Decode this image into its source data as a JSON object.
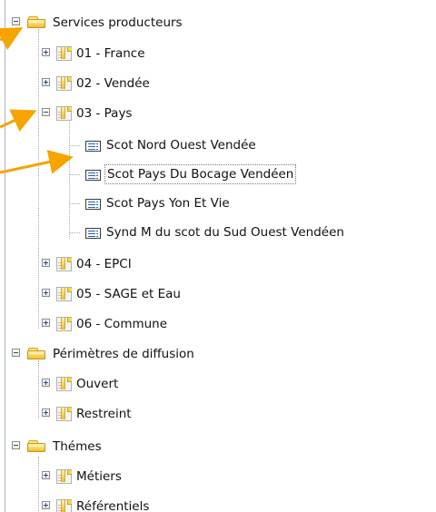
{
  "tree": {
    "services": {
      "label": "Services producteurs",
      "children": [
        {
          "label": "01 - France"
        },
        {
          "label": "02 - Vendée"
        },
        {
          "label": "03 - Pays",
          "children": [
            {
              "label": "Scot Nord Ouest Vendée"
            },
            {
              "label": "Scot Pays Du Bocage Vendéen"
            },
            {
              "label": "Scot Pays Yon Et Vie"
            },
            {
              "label": "Synd M du scot du Sud Ouest Vendéen"
            }
          ]
        },
        {
          "label": "04 - EPCI"
        },
        {
          "label": "05 - SAGE et Eau"
        },
        {
          "label": "06 - Commune"
        }
      ]
    },
    "perimetres": {
      "label": "Périmètres de diffusion",
      "children": [
        {
          "label": "Ouvert"
        },
        {
          "label": "Restreint"
        }
      ]
    },
    "themes": {
      "label": "Thémes",
      "children": [
        {
          "label": "Métiers"
        },
        {
          "label": "Référentiels"
        }
      ]
    }
  },
  "colors": {
    "arrow": "#f5a400",
    "folder": "#f2bd2e",
    "tree_lines": "#aaaaaa",
    "panel_border": "#a7b3c9"
  },
  "icons": {
    "expanded": "minus-box-icon",
    "collapsed": "plus-box-icon",
    "folder": "folder-icon",
    "package": "package-icon",
    "leaf": "document-list-icon"
  }
}
